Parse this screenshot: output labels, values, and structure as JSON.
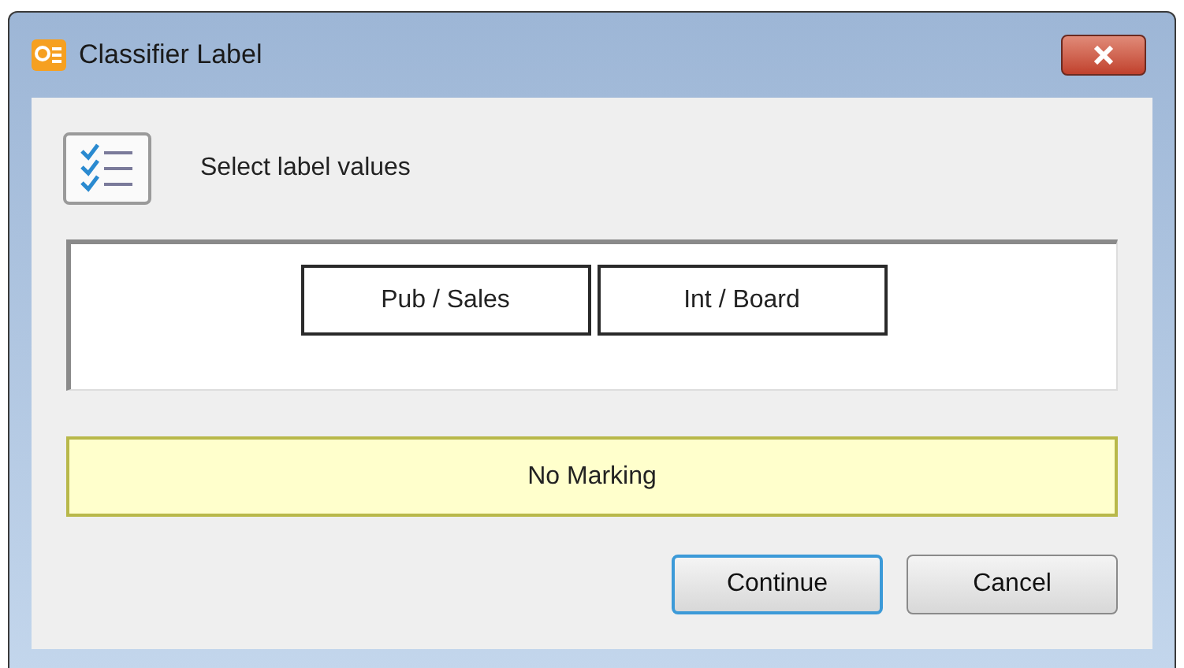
{
  "window": {
    "title": "Classifier Label"
  },
  "header": {
    "text": "Select label values"
  },
  "label_values": [
    {
      "label": "Pub / Sales"
    },
    {
      "label": "Int / Board"
    }
  ],
  "marking": {
    "text": "No Marking"
  },
  "buttons": [
    {
      "label": "Continue",
      "default": true
    },
    {
      "label": "Cancel",
      "default": false
    }
  ]
}
